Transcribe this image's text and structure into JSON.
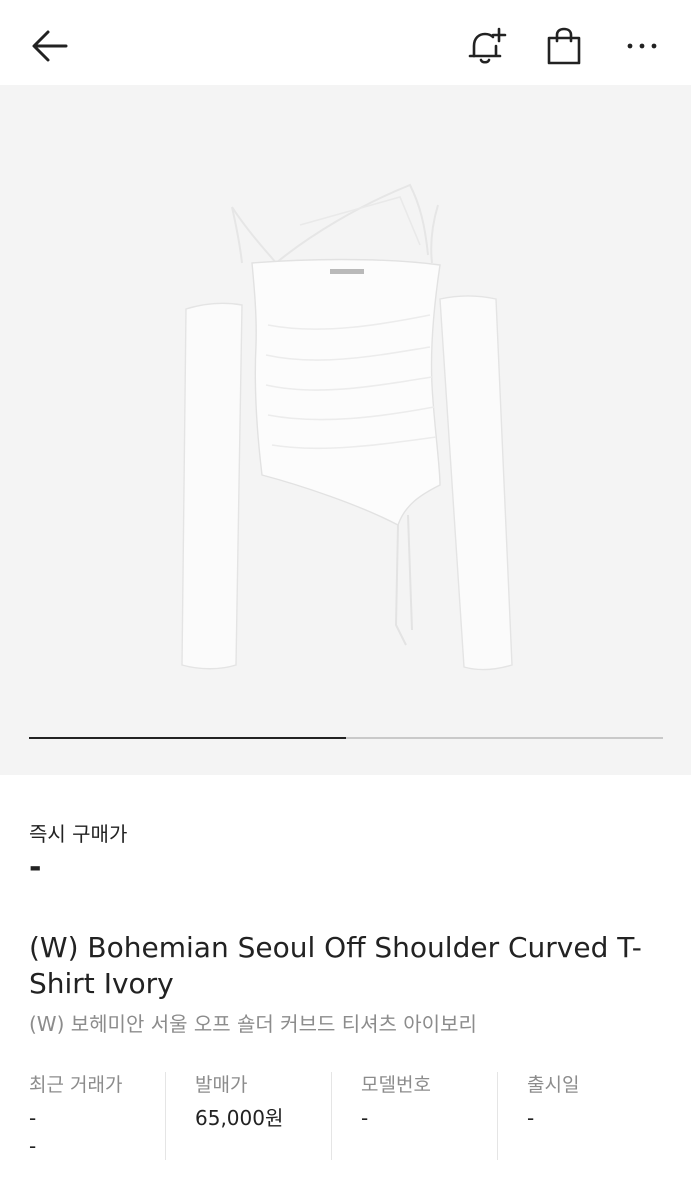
{
  "header": {
    "back_icon": "arrow-left-icon",
    "alert_icon": "bell-plus-icon",
    "bag_icon": "shopping-bag-icon",
    "more_icon": "more-horizontal-icon"
  },
  "gallery": {
    "image_subject": "ivory off-shoulder curved t-shirt",
    "progress": 0.5
  },
  "buy_now": {
    "label": "즉시 구매가",
    "price": "-"
  },
  "product": {
    "title_en": "(W) Bohemian Seoul Off Shoulder Curved T-Shirt Ivory",
    "title_ko": "(W) 보헤미안 서울 오프 숄더 커브드 티셔츠 아이보리"
  },
  "specs": [
    {
      "label": "최근 거래가",
      "value": "-",
      "value2": "-"
    },
    {
      "label": "발매가",
      "value": "65,000원"
    },
    {
      "label": "모델번호",
      "value": "-"
    },
    {
      "label": "출시일",
      "value": "-"
    }
  ],
  "colors": {
    "accent": "#222222",
    "muted": "#8c8c8c",
    "hero_bg": "#f4f4f4"
  }
}
